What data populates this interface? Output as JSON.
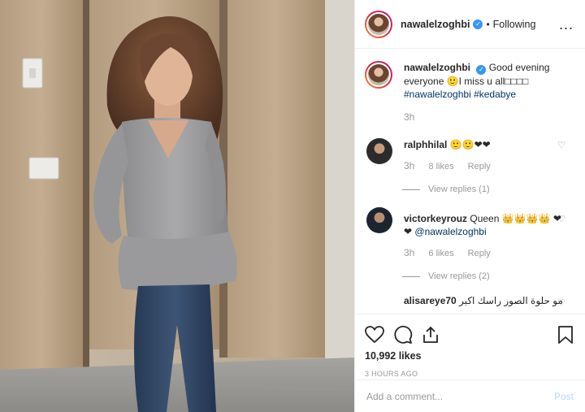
{
  "header": {
    "username": "nawalelzoghbi",
    "separator": "•",
    "follow_status": "Following",
    "more_label": "..."
  },
  "caption": {
    "username": "nawalelzoghbi",
    "text": "Good evening everyone 🙂I miss u all□□□□",
    "hashtags": "#nawalelzoghbi #kedabye",
    "time": "3h"
  },
  "comments": [
    {
      "username": "ralphhilal",
      "text": "🙂🙂❤❤",
      "time": "3h",
      "likes": "8 likes",
      "reply": "Reply",
      "view_replies": "View replies (1)"
    },
    {
      "username": "victorkeyrouz",
      "text": "Queen 👑👑👑👑 ❤❤",
      "mention": "@nawalelzoghbi",
      "time": "3h",
      "likes": "6 likes",
      "reply": "Reply",
      "view_replies": "View replies (2)"
    },
    {
      "username": "alisareye70",
      "text": "مو حلوة الصور راسك اكبر"
    }
  ],
  "actions": {
    "likes": "10,992 likes",
    "posted": "3 HOURS AGO",
    "icons": [
      "heart-icon",
      "comment-icon",
      "share-icon",
      "bookmark-icon"
    ]
  },
  "add_comment": {
    "placeholder": "Add a comment...",
    "post_label": "Post"
  },
  "colors": {
    "link": "#003569",
    "verified": "#3897f0",
    "muted": "#999999",
    "post_disabled": "#b3dbff"
  }
}
